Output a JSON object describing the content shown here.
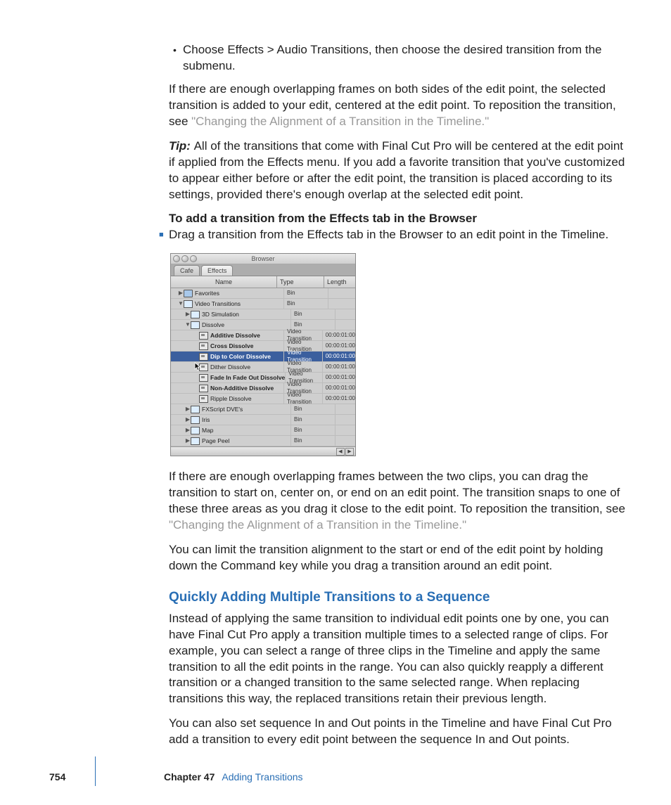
{
  "bullet1": "Choose Effects > Audio Transitions, then choose the desired transition from the submenu.",
  "p1a": "If there are enough overlapping frames on both sides of the edit point, the selected transition is added to your edit, centered at the edit point. To reposition the transition, see ",
  "p1link": "\"Changing the Alignment of a Transition in the Timeline.\"",
  "tip_label": "Tip:  ",
  "tip_body": "All of the transitions that come with Final Cut Pro will be centered at the edit point if applied from the Effects menu. If you add a favorite transition that you've customized to appear either before or after the edit point, the transition is placed according to its settings, provided there's enough overlap at the selected edit point.",
  "h_small": "To add a transition from the Effects tab in the Browser",
  "step1": "Drag a transition from the Effects tab in the Browser to an edit point in the Timeline.",
  "browser": {
    "title": "Browser",
    "tabs": [
      "Cafe",
      "Effects"
    ],
    "columns": [
      "Name",
      "Type",
      "Length"
    ],
    "rows": [
      {
        "indent": 1,
        "tri": "closed",
        "icon": "folder",
        "label": "Favorites",
        "type": "Bin",
        "len": "",
        "bold": false
      },
      {
        "indent": 1,
        "tri": "open",
        "icon": "bin",
        "label": "Video Transitions",
        "type": "Bin",
        "len": "",
        "bold": false
      },
      {
        "indent": 2,
        "tri": "closed",
        "icon": "bin",
        "label": "3D Simulation",
        "type": "Bin",
        "len": "",
        "bold": false
      },
      {
        "indent": 2,
        "tri": "open",
        "icon": "bin",
        "label": "Dissolve",
        "type": "Bin",
        "len": "",
        "bold": false
      },
      {
        "indent": 3,
        "tri": "none",
        "icon": "trans",
        "label": "Additive Dissolve",
        "type": "Video Transition",
        "len": "00:00:01:00",
        "bold": true
      },
      {
        "indent": 3,
        "tri": "none",
        "icon": "trans",
        "label": "Cross Dissolve",
        "type": "Video Transition",
        "len": "00:00:01:00",
        "bold": true
      },
      {
        "indent": 3,
        "tri": "none",
        "icon": "trans",
        "label": "Dip to Color Dissolve",
        "type": "Video Transition",
        "len": "00:00:01:00",
        "bold": true,
        "sel": true
      },
      {
        "indent": 3,
        "tri": "none",
        "icon": "trans",
        "label": "Dither Dissolve",
        "type": "Video Transition",
        "len": "00:00:01:00",
        "bold": false
      },
      {
        "indent": 3,
        "tri": "none",
        "icon": "trans",
        "label": "Fade In Fade Out Dissolve",
        "type": "Video Transition",
        "len": "00:00:01:00",
        "bold": true
      },
      {
        "indent": 3,
        "tri": "none",
        "icon": "trans",
        "label": "Non-Additive Dissolve",
        "type": "Video Transition",
        "len": "00:00:01:00",
        "bold": true
      },
      {
        "indent": 3,
        "tri": "none",
        "icon": "trans",
        "label": "Ripple Dissolve",
        "type": "Video Transition",
        "len": "00:00:01:00",
        "bold": false
      },
      {
        "indent": 2,
        "tri": "closed",
        "icon": "bin",
        "label": "FXScript DVE's",
        "type": "Bin",
        "len": "",
        "bold": false
      },
      {
        "indent": 2,
        "tri": "closed",
        "icon": "bin",
        "label": "Iris",
        "type": "Bin",
        "len": "",
        "bold": false
      },
      {
        "indent": 2,
        "tri": "closed",
        "icon": "bin",
        "label": "Map",
        "type": "Bin",
        "len": "",
        "bold": false
      },
      {
        "indent": 2,
        "tri": "closed",
        "icon": "bin",
        "label": "Page Peel",
        "type": "Bin",
        "len": "",
        "bold": false
      }
    ]
  },
  "p3a": "If there are enough overlapping frames between the two clips, you can drag the transition to start on, center on, or end on an edit point. The transition snaps to one of these three areas as you drag it close to the edit point. To reposition the transition, see ",
  "p3link": "\"Changing the Alignment of a Transition in the Timeline.\"",
  "p4": "You can limit the transition alignment to the start or end of the edit point by holding down the Command key while you drag a transition around an edit point.",
  "h_blue": "Quickly Adding Multiple Transitions to a Sequence",
  "p5": "Instead of applying the same transition to individual edit points one by one, you can have Final Cut Pro apply a transition multiple times to a selected range of clips. For example, you can select a range of three clips in the Timeline and apply the same transition to all the edit points in the range. You can also quickly reapply a different transition or a changed transition to the same selected range. When replacing transitions this way, the replaced transitions retain their previous length.",
  "p6": "You can also set sequence In and Out points in the Timeline and have Final Cut Pro add a transition to every edit point between the sequence In and Out points.",
  "footer": {
    "page": "754",
    "chapter_label": "Chapter 47",
    "chapter_title": "Adding Transitions"
  }
}
